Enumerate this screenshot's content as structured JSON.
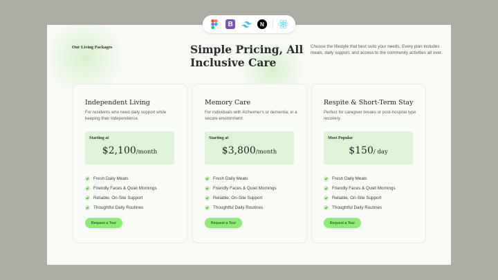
{
  "toolbar": {
    "tools": [
      "figma-icon",
      "bootstrap-icon",
      "tailwind-icon",
      "nextjs-icon",
      "react-icon"
    ],
    "bootstrap_letter": "B",
    "next_letter": "N"
  },
  "header": {
    "eyebrow": "Our Living Packages",
    "title": "Simple Pricing, All Inclusive Care",
    "intro": "Choose the lifestyle that best suits your needs. Every plan includes meals, daily support, and access to the community activities all over."
  },
  "colors": {
    "accent": "#8ded72",
    "price_box": "#dff3d6",
    "background": "#adada6",
    "canvas": "#f7f9f5"
  },
  "plans": [
    {
      "title": "Independent Living",
      "description": "For residents who need daily support while keeping their independence.",
      "price_label": "Starting at",
      "price": "$2,100",
      "period": "/month",
      "features": [
        "Fresh Daily Meals",
        "Friendly Faces & Quiet Mornings",
        "Reliable, On-Site Support",
        "Thoughtful Daily Routines"
      ],
      "button": "Request a Tour"
    },
    {
      "title": "Memory Care",
      "description": "For individuals with Alzheimer's or dementia, in a secure environment.",
      "price_label": "Starting at",
      "price": "$3,800",
      "period": "/month",
      "features": [
        "Fresh Daily Meals",
        "Friendly Faces & Quiet Mornings",
        "Reliable, On-Site Support",
        "Thoughtful Daily Routines"
      ],
      "button": "Request a Tour"
    },
    {
      "title": "Respite & Short-Term Stay",
      "description": "Perfect for caregiver breaks or post-hospital type recovery.",
      "price_label": "Most Popular",
      "price": "$150",
      "period": "/ day",
      "features": [
        "Fresh Daily Meals",
        "Friendly Faces & Quiet Mornings",
        "Reliable, On-Site Support",
        "Thoughtful Daily Routines"
      ],
      "button": "Request a Tour"
    }
  ]
}
